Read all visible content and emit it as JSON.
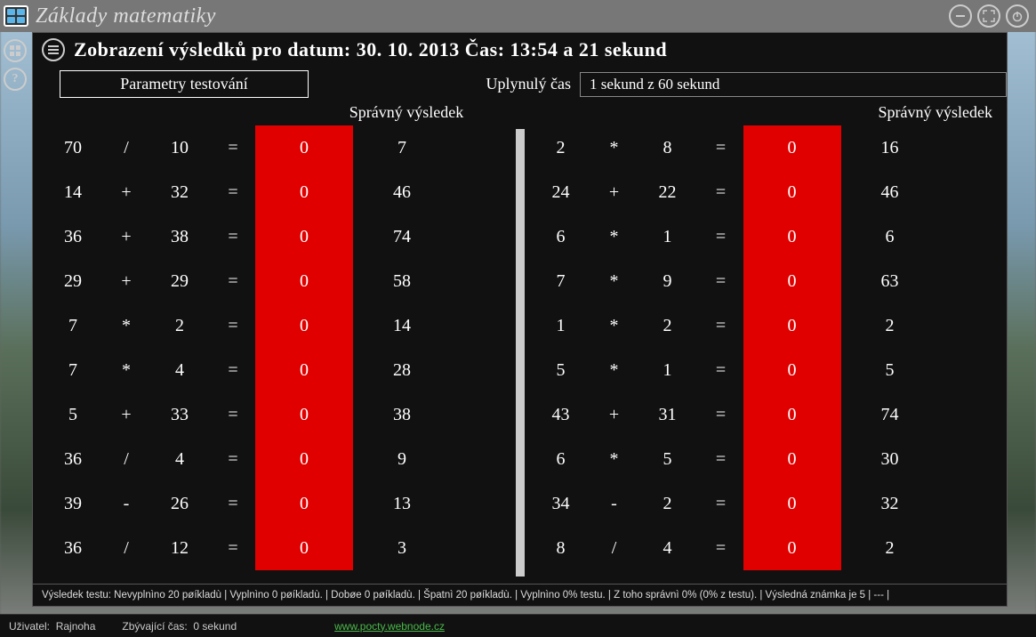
{
  "app": {
    "title": "Základy matematiky"
  },
  "panel": {
    "title": "Zobrazení výsledků pro datum: 30. 10. 2013 Čas: 13:54 a 21 sekund",
    "params_button": "Parametry testování",
    "elapsed_label": "Uplynulý čas",
    "elapsed_value": "1 sekund z 60 sekund",
    "correct_header": "Správný výsledek"
  },
  "left": [
    {
      "a": "70",
      "op": "/",
      "b": "10",
      "eq": "=",
      "ans": "0",
      "correct": "7"
    },
    {
      "a": "14",
      "op": "+",
      "b": "32",
      "eq": "=",
      "ans": "0",
      "correct": "46"
    },
    {
      "a": "36",
      "op": "+",
      "b": "38",
      "eq": "=",
      "ans": "0",
      "correct": "74"
    },
    {
      "a": "29",
      "op": "+",
      "b": "29",
      "eq": "=",
      "ans": "0",
      "correct": "58"
    },
    {
      "a": "7",
      "op": "*",
      "b": "2",
      "eq": "=",
      "ans": "0",
      "correct": "14"
    },
    {
      "a": "7",
      "op": "*",
      "b": "4",
      "eq": "=",
      "ans": "0",
      "correct": "28"
    },
    {
      "a": "5",
      "op": "+",
      "b": "33",
      "eq": "=",
      "ans": "0",
      "correct": "38"
    },
    {
      "a": "36",
      "op": "/",
      "b": "4",
      "eq": "=",
      "ans": "0",
      "correct": "9"
    },
    {
      "a": "39",
      "op": "-",
      "b": "26",
      "eq": "=",
      "ans": "0",
      "correct": "13"
    },
    {
      "a": "36",
      "op": "/",
      "b": "12",
      "eq": "=",
      "ans": "0",
      "correct": "3"
    }
  ],
  "right": [
    {
      "a": "2",
      "op": "*",
      "b": "8",
      "eq": "=",
      "ans": "0",
      "correct": "16"
    },
    {
      "a": "24",
      "op": "+",
      "b": "22",
      "eq": "=",
      "ans": "0",
      "correct": "46"
    },
    {
      "a": "6",
      "op": "*",
      "b": "1",
      "eq": "=",
      "ans": "0",
      "correct": "6"
    },
    {
      "a": "7",
      "op": "*",
      "b": "9",
      "eq": "=",
      "ans": "0",
      "correct": "63"
    },
    {
      "a": "1",
      "op": "*",
      "b": "2",
      "eq": "=",
      "ans": "0",
      "correct": "2"
    },
    {
      "a": "5",
      "op": "*",
      "b": "1",
      "eq": "=",
      "ans": "0",
      "correct": "5"
    },
    {
      "a": "43",
      "op": "+",
      "b": "31",
      "eq": "=",
      "ans": "0",
      "correct": "74"
    },
    {
      "a": "6",
      "op": "*",
      "b": "5",
      "eq": "=",
      "ans": "0",
      "correct": "30"
    },
    {
      "a": "34",
      "op": "-",
      "b": "2",
      "eq": "=",
      "ans": "0",
      "correct": "32"
    },
    {
      "a": "8",
      "op": "/",
      "b": "4",
      "eq": "=",
      "ans": "0",
      "correct": "2"
    }
  ],
  "summary": "Výsledek testu:    Nevyplnìno 20 pøíkladù  |  Vyplnìno 0 pøíkladù.  |  Dobøe 0 pøíkladù.  |  Špatnì 20 pøíkladù.  |  Vyplnìno 0% testu.  |  Z toho správnì 0% (0% z testu).  |  Výsledná známka je 5  |  ---  |",
  "bottom": {
    "user_label": "Uživatel:",
    "user_value": "Rajnoha",
    "time_label": "Zbývající čas:",
    "time_value": "0 sekund",
    "link": "www.pocty.webnode.cz"
  }
}
